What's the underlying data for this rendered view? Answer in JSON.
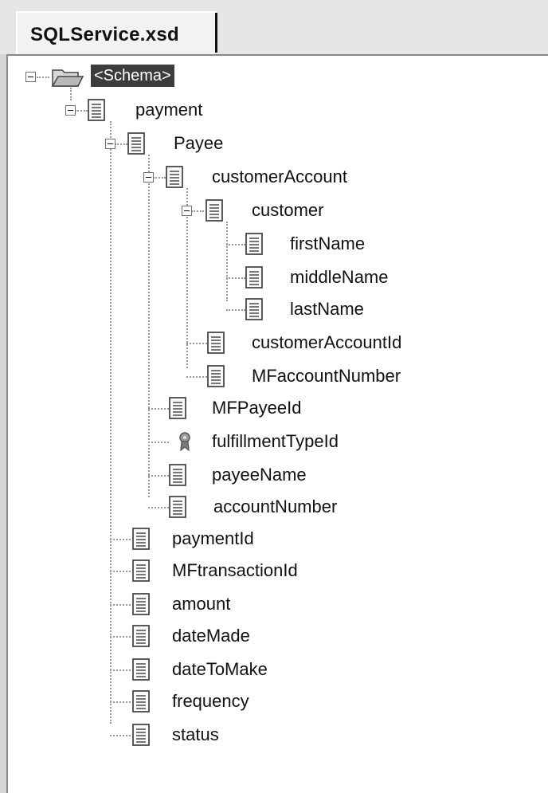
{
  "tab": {
    "title": "SQLService.xsd"
  },
  "tree": {
    "root_label": "<Schema>",
    "payment": "payment",
    "payee": "Payee",
    "customer_account": "customerAccount",
    "customer": "customer",
    "first_name": "firstName",
    "middle_name": "middleName",
    "last_name": "lastName",
    "customer_account_id": "customerAccountId",
    "mf_account_number": "MFaccountNumber",
    "mf_payee_id": "MFPayeeId",
    "fulfillment_type_id": "fulfillmentTypeId",
    "payee_name": "payeeName",
    "account_number": "accountNumber",
    "payment_id": "paymentId",
    "mf_transaction_id": "MFtransactionId",
    "amount": "amount",
    "date_made": "dateMade",
    "date_to_make": "dateToMake",
    "frequency": "frequency",
    "status": "status"
  },
  "icons": {
    "root": "folder-open-icon",
    "element": "document-icon",
    "key": "key-icon",
    "expander": "collapse-minus-icon"
  }
}
